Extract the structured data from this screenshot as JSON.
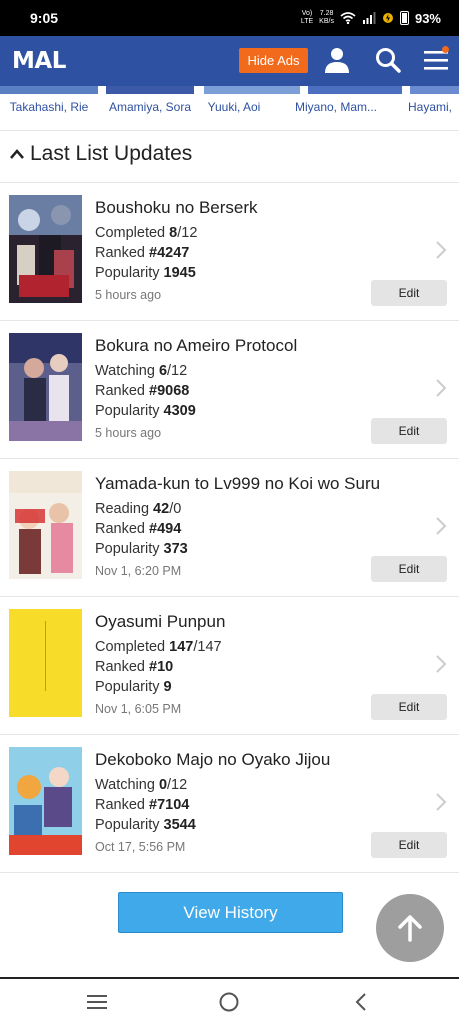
{
  "status_bar": {
    "time": "9:05",
    "net_speed_top": "7.28",
    "net_speed_bottom": "KB/s",
    "volte_top": "Vo)",
    "volte_bottom": "LTE",
    "battery": "93%"
  },
  "header": {
    "logo": "MAL",
    "hide_ads_label": "Hide Ads",
    "brand_color": "#2e51a2",
    "accent_color": "#f26b1d"
  },
  "voice_actors": [
    "Takahashi, Rie",
    "Amamiya, Sora",
    "Yuuki, Aoi",
    "Miyano, Mam...",
    "Hayami,"
  ],
  "section": {
    "title": "Last List Updates"
  },
  "items": [
    {
      "title": "Boushoku no Berserk",
      "status": "Completed",
      "progress": "8",
      "total": "/12",
      "ranked_label": "Ranked",
      "rank": "#4247",
      "pop_label": "Popularity",
      "popularity": "1945",
      "time": "5 hours ago",
      "edit_label": "Edit"
    },
    {
      "title": "Bokura no Ameiro Protocol",
      "status": "Watching",
      "progress": "6",
      "total": "/12",
      "ranked_label": "Ranked",
      "rank": "#9068",
      "pop_label": "Popularity",
      "popularity": "4309",
      "time": "5 hours ago",
      "edit_label": "Edit"
    },
    {
      "title": "Yamada-kun to Lv999 no Koi wo Suru",
      "status": "Reading",
      "progress": "42",
      "total": "/0",
      "ranked_label": "Ranked",
      "rank": "#494",
      "pop_label": "Popularity",
      "popularity": "373",
      "time": "Nov 1, 6:20 PM",
      "edit_label": "Edit"
    },
    {
      "title": "Oyasumi Punpun",
      "status": "Completed",
      "progress": "147",
      "total": "/147",
      "ranked_label": "Ranked",
      "rank": "#10",
      "pop_label": "Popularity",
      "popularity": "9",
      "time": "Nov 1, 6:05 PM",
      "edit_label": "Edit"
    },
    {
      "title": "Dekoboko Majo no Oyako Jijou",
      "status": "Watching",
      "progress": "0",
      "total": "/12",
      "ranked_label": "Ranked",
      "rank": "#7104",
      "pop_label": "Popularity",
      "popularity": "3544",
      "time": "Oct 17, 5:56 PM",
      "edit_label": "Edit"
    }
  ],
  "footer": {
    "view_history_label": "View History"
  }
}
